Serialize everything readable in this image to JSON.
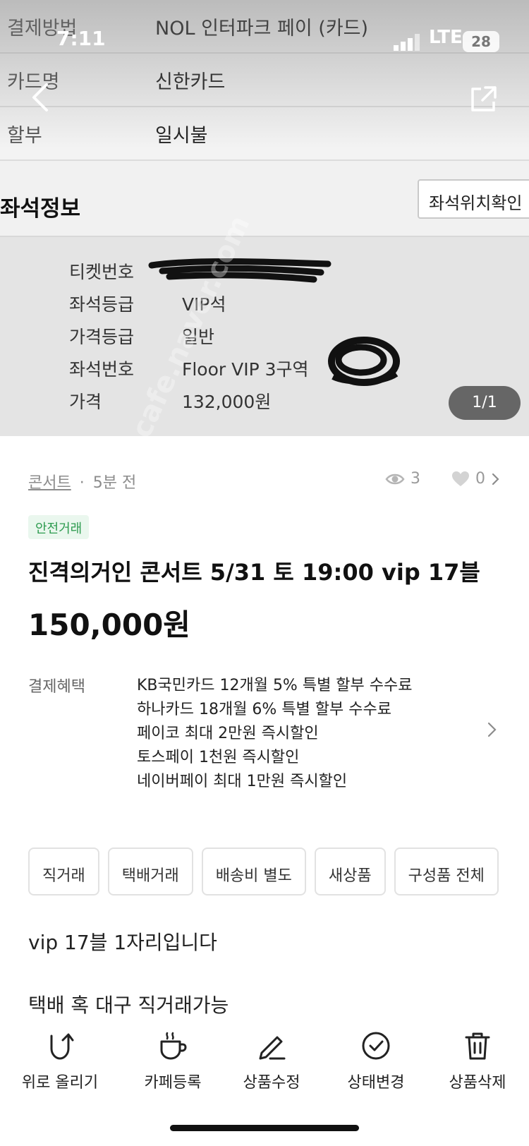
{
  "status_bar": {
    "time": "7:11",
    "network": "LTE",
    "battery": "28"
  },
  "screenshot": {
    "payment_rows": [
      {
        "label": "결제방법",
        "value": "NOL 인터파크 페이 (카드)"
      },
      {
        "label": "카드명",
        "value": "신한카드"
      },
      {
        "label": "할부",
        "value": "일시불"
      }
    ],
    "seat_section_title": "좌석정보",
    "seat_location_button": "좌석위치확인",
    "seat_rows": [
      {
        "label": "티켓번호",
        "value": ""
      },
      {
        "label": "좌석등급",
        "value": "VIP석"
      },
      {
        "label": "가격등급",
        "value": "일반"
      },
      {
        "label": "좌석번호",
        "value": "Floor VIP 3구역"
      },
      {
        "label": "가격",
        "value": "132,000원"
      }
    ],
    "pager": "1/1",
    "watermark": "cafe.naver.com"
  },
  "listing": {
    "category": "콘서트",
    "time_ago": "5분 전",
    "views": "3",
    "likes": "0",
    "safe_badge": "안전거래",
    "title": "진격의거인 콘서트 5/31 토 19:00 vip 17블",
    "price": "150,000원",
    "benefit_label": "결제혜택",
    "benefits": [
      "KB국민카드 12개월 5% 특별 할부 수수료",
      "하나카드 18개월 6% 특별 할부 수수료",
      "페이코 최대 2만원 즉시할인",
      "토스페이 1천원 즉시할인",
      "네이버페이 최대 1만원 즉시할인"
    ],
    "tags": [
      "직거래",
      "택배거래",
      "배송비 별도",
      "새상품",
      "구성품 전체"
    ],
    "description": [
      "vip 17블 1자리입니다",
      "택배 혹 대구 직거래가능"
    ]
  },
  "bottom_bar": [
    {
      "label": "위로 올리기",
      "icon": "up-arrow-icon"
    },
    {
      "label": "카페등록",
      "icon": "coffee-cup-icon"
    },
    {
      "label": "상품수정",
      "icon": "pencil-icon"
    },
    {
      "label": "상태변경",
      "icon": "check-circle-icon"
    },
    {
      "label": "상품삭제",
      "icon": "trash-icon"
    }
  ]
}
